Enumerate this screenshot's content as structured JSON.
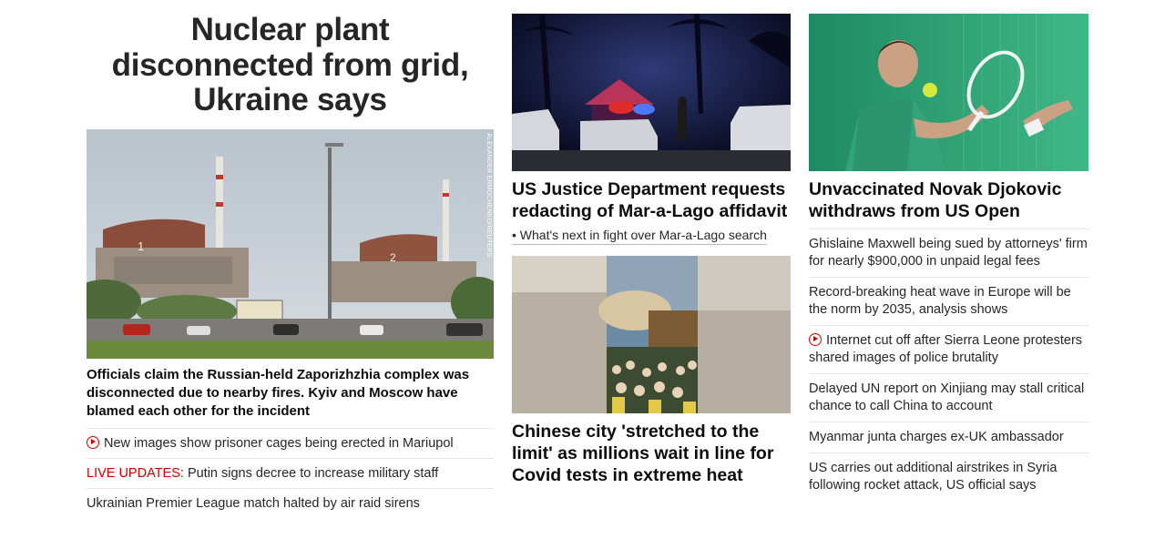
{
  "hero": {
    "title": "Nuclear plant disconnected from grid, Ukraine says",
    "image_credit": "ALEXANDER ERMOCHENKO/REUTERS",
    "summary": "Officials claim the Russian-held Zaporizhzhia complex was disconnected due to nearby fires. Kyiv and Moscow have blamed each other for the incident",
    "links": [
      {
        "text": "New images show prisoner cages being erected in Mariupol",
        "video": true,
        "prefix": ""
      },
      {
        "text": "Putin signs decree to increase military staff",
        "video": false,
        "prefix": "LIVE UPDATES:"
      },
      {
        "text": "Ukrainian Premier League match halted by air raid sirens",
        "video": false,
        "prefix": ""
      }
    ]
  },
  "middle": {
    "story1": {
      "title": "US Justice Department requests redacting of Mar-a-Lago affidavit",
      "sublink": "• What's next in fight over Mar-a-Lago search"
    },
    "story2": {
      "title": "Chinese city 'stretched to the limit' as millions wait in line for Covid tests in extreme heat"
    }
  },
  "right": {
    "title": "Unvaccinated Novak Djokovic withdraws from US Open",
    "links": [
      {
        "text": "Ghislaine Maxwell being sued by attorneys' firm for nearly $900,000 in unpaid legal fees",
        "video": false
      },
      {
        "text": "Record-breaking heat wave in Europe will be the norm by 2035, analysis shows",
        "video": false
      },
      {
        "text": "Internet cut off after Sierra Leone protesters shared images of police brutality",
        "video": true
      },
      {
        "text": "Delayed UN report on Xinjiang may stall critical chance to call China to account",
        "video": false
      },
      {
        "text": "Myanmar junta charges ex-UK ambassador",
        "video": false
      },
      {
        "text": "US carries out additional airstrikes in Syria following rocket attack, US official says",
        "video": false
      }
    ]
  },
  "icons": {
    "video": "play-circle-icon"
  },
  "colors": {
    "live": "#cc0000",
    "text": "#0c0c0c",
    "divider": "#e6e6e6"
  }
}
